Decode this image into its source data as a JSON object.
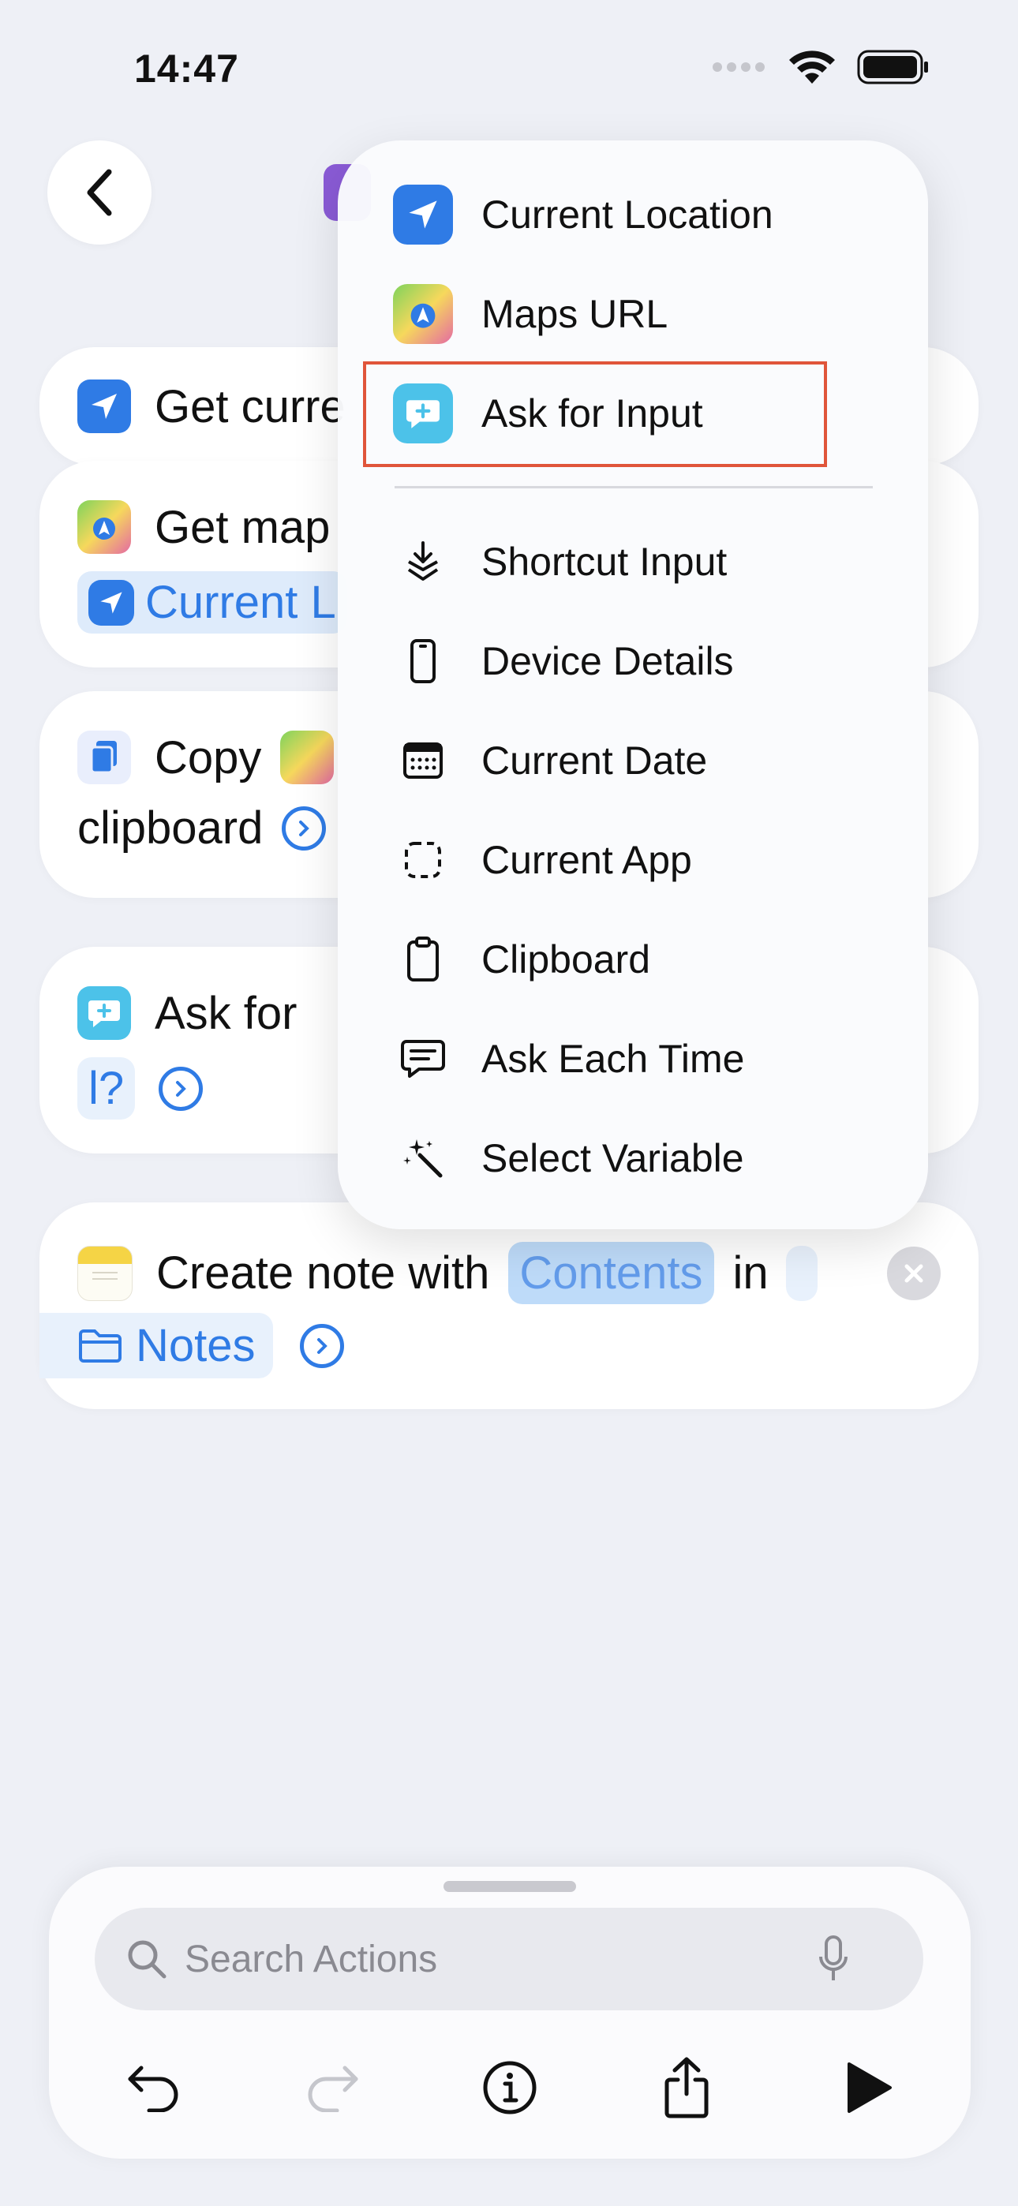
{
  "status_bar": {
    "time": "14:47"
  },
  "actions": [
    {
      "text": "Get curre"
    },
    {
      "text": "Get map",
      "pill": "Current L"
    },
    {
      "text": "Copy",
      "line2": "clipboard"
    },
    {
      "text": "Ask for",
      "line2_pill": "l?"
    },
    {
      "text": "Create note with",
      "pill": "Contents",
      "after": "in",
      "line2_pill": "Notes"
    }
  ],
  "menu": {
    "items": [
      {
        "label": "Current Location",
        "icon": "location-arrow-icon"
      },
      {
        "label": "Maps URL",
        "icon": "maps-icon"
      },
      {
        "label": "Ask for Input",
        "icon": "ask-for-input-icon"
      },
      {
        "label": "Shortcut Input",
        "icon": "shortcut-input-icon"
      },
      {
        "label": "Device Details",
        "icon": "phone-icon"
      },
      {
        "label": "Current Date",
        "icon": "calendar-icon"
      },
      {
        "label": "Current App",
        "icon": "dashed-square-icon"
      },
      {
        "label": "Clipboard",
        "icon": "clipboard-icon"
      },
      {
        "label": "Ask Each Time",
        "icon": "speech-bubble-icon"
      },
      {
        "label": "Select Variable",
        "icon": "magic-wand-icon"
      }
    ],
    "highlighted": "Ask for Input"
  },
  "bottom_sheet": {
    "search_placeholder": "Search Actions"
  },
  "colors": {
    "accent": "#2f7be5",
    "highlight_border": "#e0553a"
  }
}
